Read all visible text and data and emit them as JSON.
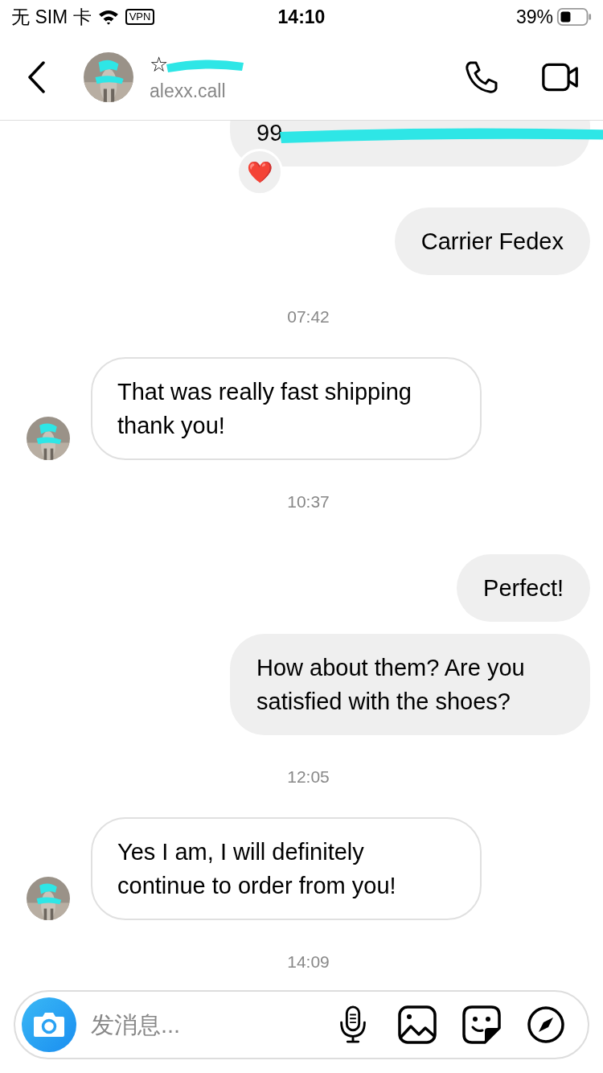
{
  "status_bar": {
    "carrier": "无 SIM 卡",
    "vpn": "VPN",
    "time": "14:10",
    "battery": "39%"
  },
  "header": {
    "name": "☆",
    "name_redacted": true,
    "username": "alexx.call"
  },
  "messages": [
    {
      "kind": "outgoing",
      "text": "99",
      "redacted": true,
      "reaction": "❤️"
    },
    {
      "kind": "outgoing",
      "text": "Carrier Fedex"
    },
    {
      "kind": "timestamp",
      "text": "07:42"
    },
    {
      "kind": "incoming",
      "text": "That was really fast shipping thank you!"
    },
    {
      "kind": "timestamp",
      "text": "10:37"
    },
    {
      "kind": "outgoing",
      "text": "Perfect!"
    },
    {
      "kind": "outgoing",
      "text": "How about them? Are you satisfied with the shoes?"
    },
    {
      "kind": "timestamp",
      "text": "12:05"
    },
    {
      "kind": "incoming",
      "text": "Yes I am, I will definitely continue to order from you!"
    },
    {
      "kind": "timestamp",
      "text": "14:09"
    }
  ],
  "composer": {
    "placeholder": "发消息..."
  }
}
